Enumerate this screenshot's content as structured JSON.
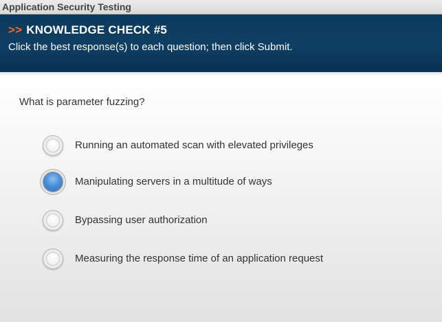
{
  "window": {
    "title": "Application Security Testing"
  },
  "header": {
    "arrows": ">>",
    "title": "KNOWLEDGE CHECK #5",
    "instruction": "Click the best response(s) to each question; then click Submit."
  },
  "question": {
    "text": "What is parameter fuzzing?",
    "options": [
      {
        "label": "Running an automated scan with elevated privileges",
        "selected": false
      },
      {
        "label": "Manipulating servers in a multitude of ways",
        "selected": true
      },
      {
        "label": "Bypassing user authorization",
        "selected": false
      },
      {
        "label": "Measuring the response time of an application request",
        "selected": false
      }
    ]
  },
  "colors": {
    "header_bg": "#0e3f64",
    "accent": "#f26b1d",
    "selected_radio": "#4a8fd8"
  }
}
